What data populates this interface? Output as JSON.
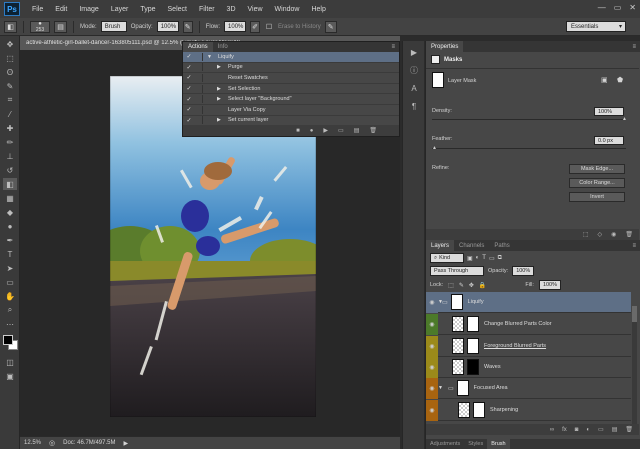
{
  "app": {
    "logo": "Ps",
    "window_controls": [
      "—",
      "▭",
      "✕"
    ]
  },
  "menu": [
    "File",
    "Edit",
    "Image",
    "Layer",
    "Type",
    "Select",
    "Filter",
    "3D",
    "View",
    "Window",
    "Help"
  ],
  "options": {
    "brush_size": "253",
    "mode_label": "Mode:",
    "mode_value": "Brush",
    "opacity_label": "Opacity:",
    "opacity_value": "100%",
    "flow_label": "Flow:",
    "flow_value": "100%",
    "erase_history": "Erase to History",
    "workspace": "Essentials"
  },
  "document": {
    "tab_title": "active-athletic-girl-ballet-dancer-163805111.psd @ 12.5% (Liquify, Layer Mask/8)",
    "zoom": "12.5%",
    "doc_size": "Doc: 46.7M/497.5M"
  },
  "actions_panel": {
    "tabs": [
      "Actions",
      "Info"
    ],
    "items": [
      {
        "label": "Liquify",
        "indent": 0,
        "arrow": "▼",
        "selected": true
      },
      {
        "label": "Purge",
        "indent": 1,
        "arrow": "▶",
        "selected": false
      },
      {
        "label": "Reset Swatches",
        "indent": 1,
        "arrow": "",
        "selected": false
      },
      {
        "label": "Set Selection",
        "indent": 1,
        "arrow": "▶",
        "selected": false
      },
      {
        "label": "Select layer \"Background\"",
        "indent": 1,
        "arrow": "▶",
        "selected": false
      },
      {
        "label": "Layer Via Copy",
        "indent": 1,
        "arrow": "",
        "selected": false
      },
      {
        "label": "Set current layer",
        "indent": 1,
        "arrow": "▶",
        "selected": false
      }
    ],
    "footer_icons": [
      "■",
      "●",
      "▶",
      "▭",
      "▤",
      "🗑"
    ]
  },
  "properties": {
    "tabs": [
      "Properties"
    ],
    "title": "Masks",
    "mask_label": "Layer Mask",
    "density_label": "Density:",
    "density_value": "100%",
    "feather_label": "Feather:",
    "feather_value": "0.0 px",
    "refine_label": "Refine:",
    "buttons": [
      "Mask Edge...",
      "Color Range...",
      "Invert"
    ]
  },
  "layers": {
    "tabs": [
      "Layers",
      "Channels",
      "Paths"
    ],
    "kind_label": "Kind",
    "blend_mode": "Pass Through",
    "opacity_label": "Opacity:",
    "opacity_value": "100%",
    "lock_label": "Lock:",
    "fill_label": "Fill:",
    "fill_value": "100%",
    "rows": [
      {
        "name": "Liquify",
        "color": "#5e6f86",
        "group": true,
        "underline": false
      },
      {
        "name": "Change Blurred Parts Color",
        "color": "#4c7a2a",
        "group": false,
        "underline": false
      },
      {
        "name": "Foreground Blurred Parts",
        "color": "#9b8a1a",
        "group": false,
        "underline": true
      },
      {
        "name": "Waves",
        "color": "#9b8a1a",
        "group": false,
        "underline": false
      },
      {
        "name": "Focused Area",
        "color": "#a86410",
        "group": true,
        "underline": false
      },
      {
        "name": "Sharpening",
        "color": "#a86410",
        "group": false,
        "underline": false
      }
    ],
    "bottom_tabs": [
      "Adjustments",
      "Styles",
      "Brush"
    ]
  },
  "colors": {
    "accent_selected": "#5e6f86",
    "panel_bg": "#474747",
    "canvas_bg": "#282828"
  }
}
